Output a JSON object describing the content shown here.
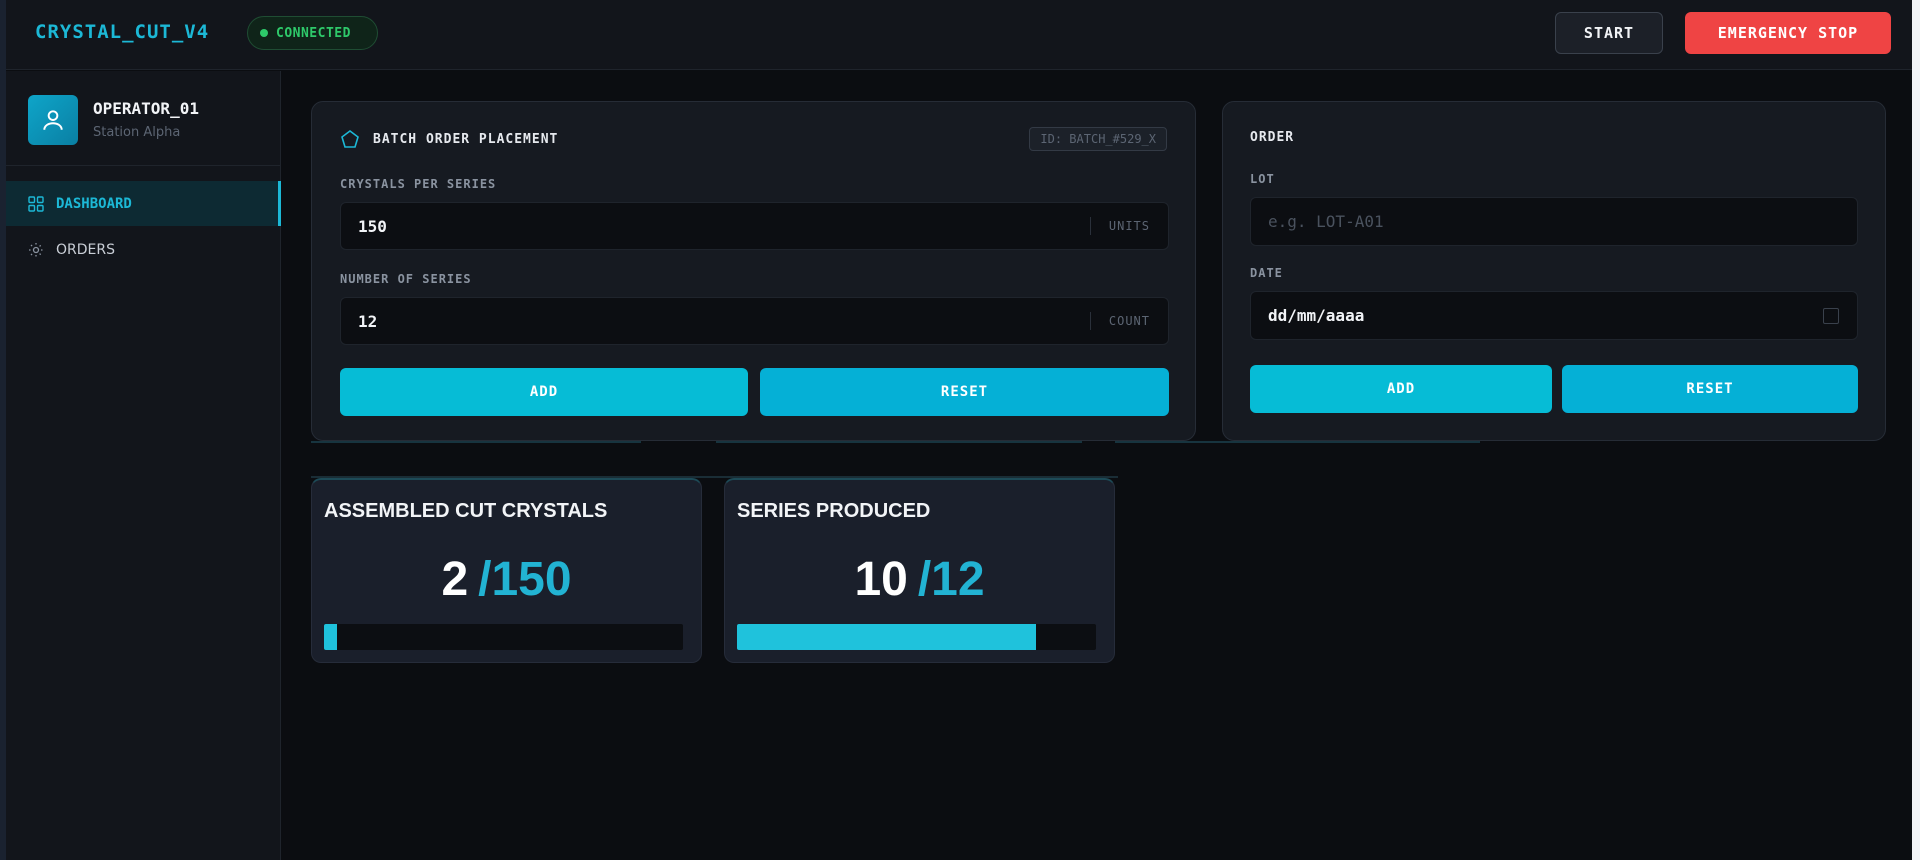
{
  "app": {
    "title": "CRYSTAL_CUT_V4",
    "status": "CONNECTED"
  },
  "toolbar": {
    "start_label": "START",
    "stop_label": "EMERGENCY STOP"
  },
  "user": {
    "name": "OPERATOR_01",
    "station": "Station Alpha"
  },
  "nav": {
    "items": [
      {
        "label": "DASHBOARD",
        "icon": "grid-icon",
        "active": true
      },
      {
        "label": "ORDERS",
        "icon": "gear-icon",
        "active": false
      }
    ]
  },
  "batch": {
    "title": "BATCH ORDER PLACEMENT",
    "id_badge": "ID: BATCH_#529_X",
    "crystals_label": "CRYSTALS PER SERIES",
    "crystals_value": "150",
    "crystals_unit": "UNITS",
    "series_label": "NUMBER OF SERIES",
    "series_value": "12",
    "series_unit": "COUNT",
    "add_label": "ADD",
    "reset_label": "RESET"
  },
  "order": {
    "title": "ORDER",
    "lot_label": "LOT",
    "lot_placeholder": "e.g. LOT-A01",
    "date_label": "DATE",
    "date_value": "dd/mm/aaaa",
    "add_label": "ADD",
    "reset_label": "RESET"
  },
  "stats": [
    {
      "title": "ASSEMBLED CUT CRYSTALS",
      "current": "2",
      "total": "/150",
      "progress": 0.0133
    },
    {
      "title": "SERIES PRODUCED",
      "current": "10",
      "total": "/12",
      "progress": 0.8333
    }
  ],
  "colors": {
    "accent": "#1cb8d6",
    "success": "#2ec96a",
    "danger": "#ef4444"
  }
}
